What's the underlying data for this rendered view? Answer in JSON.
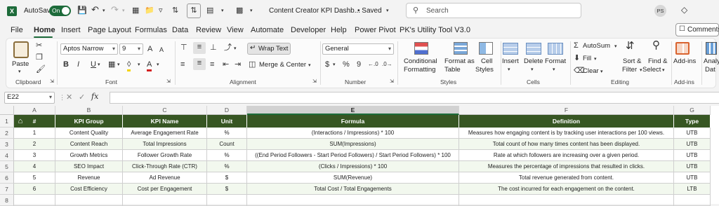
{
  "titlebar": {
    "autosave_label": "AutoSave",
    "autosave_state": "On",
    "doc_title": "Content Creator KPI Dashb...",
    "doc_status": "• Saved",
    "search_placeholder": "Search",
    "user_initials": "PS"
  },
  "menu": {
    "tabs": [
      "File",
      "Home",
      "Insert",
      "Page Layout",
      "Formulas",
      "Data",
      "Review",
      "View",
      "Automate",
      "Developer",
      "Help",
      "Power Pivot",
      "PK's Utility Tool V3.0"
    ],
    "active": "Home",
    "comments_label": "Comments"
  },
  "ribbon": {
    "clipboard": {
      "paste": "Paste",
      "group": "Clipboard"
    },
    "font": {
      "name": "Aptos Narrow",
      "size": "9",
      "bold": "B",
      "italic": "I",
      "underline": "U",
      "grow": "A",
      "shrink": "A",
      "group": "Font"
    },
    "alignment": {
      "wrap": "Wrap Text",
      "merge": "Merge & Center",
      "group": "Alignment"
    },
    "number": {
      "format": "General",
      "currency": "$",
      "percent": "%",
      "comma": "9",
      "group": "Number"
    },
    "styles": {
      "conditional_1": "Conditional",
      "conditional_2": "Formatting",
      "format_table_1": "Format as",
      "format_table_2": "Table",
      "cell_styles_1": "Cell",
      "cell_styles_2": "Styles",
      "group": "Styles"
    },
    "cells": {
      "insert": "Insert",
      "delete": "Delete",
      "format": "Format",
      "group": "Cells"
    },
    "editing": {
      "autosum": "AutoSum",
      "fill": "Fill",
      "clear": "Clear",
      "sort_1": "Sort &",
      "sort_2": "Filter",
      "find_1": "Find &",
      "find_2": "Select",
      "group": "Editing"
    },
    "addins": {
      "label": "Add-ins",
      "group": "Add-ins"
    },
    "analyze": {
      "label_1": "Analy",
      "label_2": "Dat"
    }
  },
  "formulabar": {
    "name_box": "E22",
    "fx": "fx",
    "formula": ""
  },
  "sheet": {
    "columns": [
      "A",
      "B",
      "C",
      "D",
      "E",
      "F",
      "G"
    ],
    "selected_column": "E",
    "selected_row": "22",
    "row_numbers": [
      "1",
      "2",
      "3",
      "4",
      "5",
      "6",
      "7",
      "8"
    ],
    "header": [
      "#",
      "KPI Group",
      "KPI Name",
      "Unit",
      "Formula",
      "Definition",
      "Type"
    ],
    "rows": [
      [
        "1",
        "Content Quality",
        "Average Engagement Rate",
        "%",
        "(Interactions / Impressions) * 100",
        "Measures how engaging content is by tracking user interactions per 100 views.",
        "UTB"
      ],
      [
        "2",
        "Content Reach",
        "Total Impressions",
        "Count",
        "SUM(Impressions)",
        "Total count of how many times content has been displayed.",
        "UTB"
      ],
      [
        "3",
        "Growth Metrics",
        "Follower Growth Rate",
        "%",
        "((End Period Followers - Start Period Followers) / Start Period Followers) * 100",
        "Rate at which followers are increasing over a given period.",
        "UTB"
      ],
      [
        "4",
        "SEO Impact",
        "Click-Through Rate (CTR)",
        "%",
        "(Clicks / Impressions) * 100",
        "Measures the percentage of impressions that resulted in clicks.",
        "UTB"
      ],
      [
        "5",
        "Revenue",
        "Ad Revenue",
        "$",
        "SUM(Revenue)",
        "Total revenue generated from content.",
        "UTB"
      ],
      [
        "6",
        "Cost Efficiency",
        "Cost per Engagement",
        "$",
        "Total Cost / Total Engagements",
        "The cost incurred for each engagement on the content.",
        "LTB"
      ]
    ]
  },
  "colors": {
    "header_green": "#375623",
    "excel_green": "#1d6b3a",
    "stripe": "#f2f8ee"
  }
}
